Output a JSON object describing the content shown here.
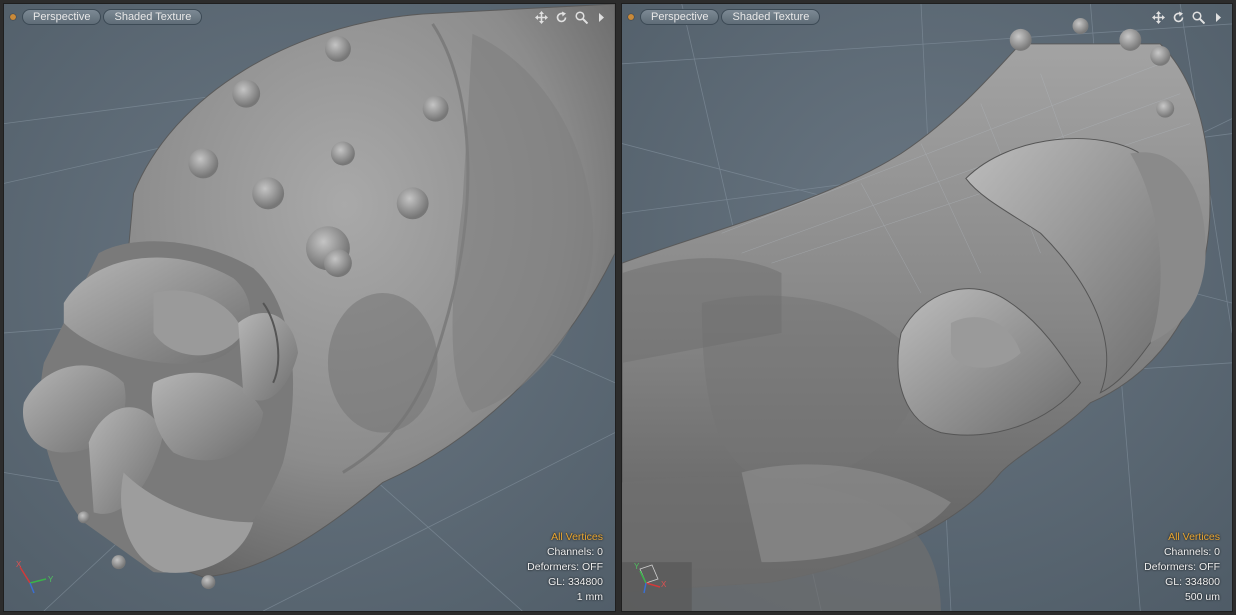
{
  "viewports": [
    {
      "view_label": "Perspective",
      "shading_label": "Shaded Texture",
      "tools": [
        "move-icon",
        "rotate-icon",
        "zoom-icon",
        "menu-arrow-icon"
      ],
      "info": {
        "selection": "All Vertices",
        "channels": "Channels: 0",
        "deformers": "Deformers: OFF",
        "gl": "GL: 334800",
        "scale": "1 mm"
      },
      "axes": {
        "x": "X",
        "y": "Y"
      }
    },
    {
      "view_label": "Perspective",
      "shading_label": "Shaded Texture",
      "tools": [
        "move-icon",
        "rotate-icon",
        "zoom-icon",
        "menu-arrow-icon"
      ],
      "info": {
        "selection": "All Vertices",
        "channels": "Channels: 0",
        "deformers": "Deformers: OFF",
        "gl": "GL: 334800",
        "scale": "500 um"
      },
      "axes": {
        "x": "X",
        "y": "Y"
      }
    }
  ],
  "colors": {
    "viewport_bg": "#5c6a76",
    "grid": "#7d8b97",
    "model": "#8e8e8e",
    "selection_text": "#e8a530",
    "info_text": "#f0f0f0"
  }
}
